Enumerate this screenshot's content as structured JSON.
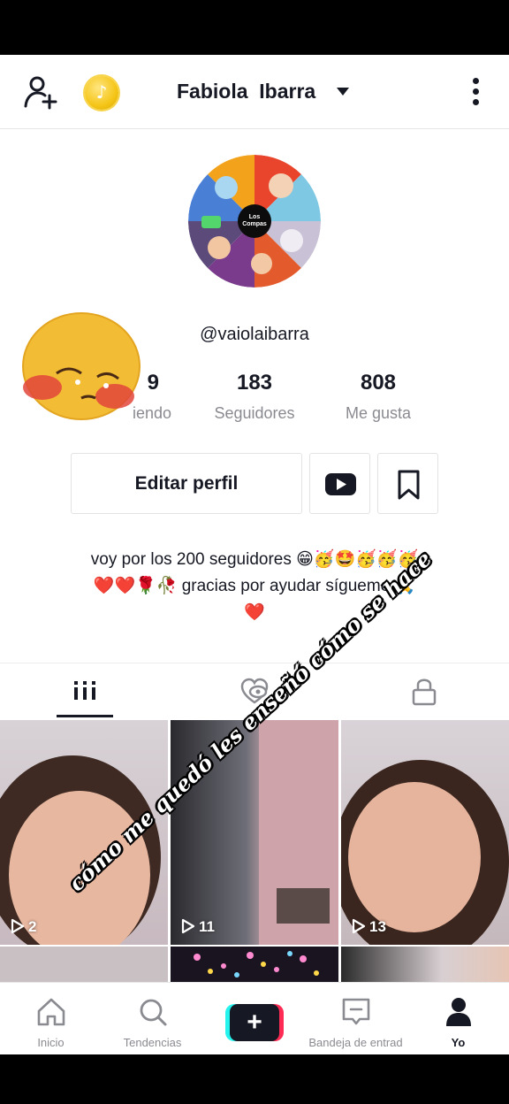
{
  "header": {
    "title": "Fabiola  Ibarra",
    "coin_symbol": "♪",
    "add_friend_icon": "person-plus-icon",
    "more_icon": "vertical-dots-icon"
  },
  "profile": {
    "username": "@vaiolaibarra",
    "avatar_label": "Los\nCompas",
    "stats": {
      "following_count": "9",
      "following_label": "iendo",
      "followers_count": "183",
      "followers_label": "Seguidores",
      "likes_count": "808",
      "likes_label": "Me gusta"
    },
    "edit_button": "Editar perfil",
    "bio_line1": "voy por los 200 seguidores 😁🥳🤩🥳🥳🥳",
    "bio_line2": "❤️❤️🌹🥀 gracias por ayudar sígueme 🙏",
    "bio_line3": "❤️"
  },
  "overlay_caption": "cómo me quedó les enseñó cómo se hace",
  "videos": [
    {
      "views": "2"
    },
    {
      "views": "11"
    },
    {
      "views": "13"
    }
  ],
  "nav": {
    "home": "Inicio",
    "discover": "Tendencias",
    "create": "+",
    "inbox": "Bandeja de entrad",
    "me": "Yo"
  },
  "colors": {
    "text": "#161823",
    "secondary": "#8a8b91",
    "accent_pink": "#fe2c55",
    "accent_cyan": "#25f4ee"
  }
}
